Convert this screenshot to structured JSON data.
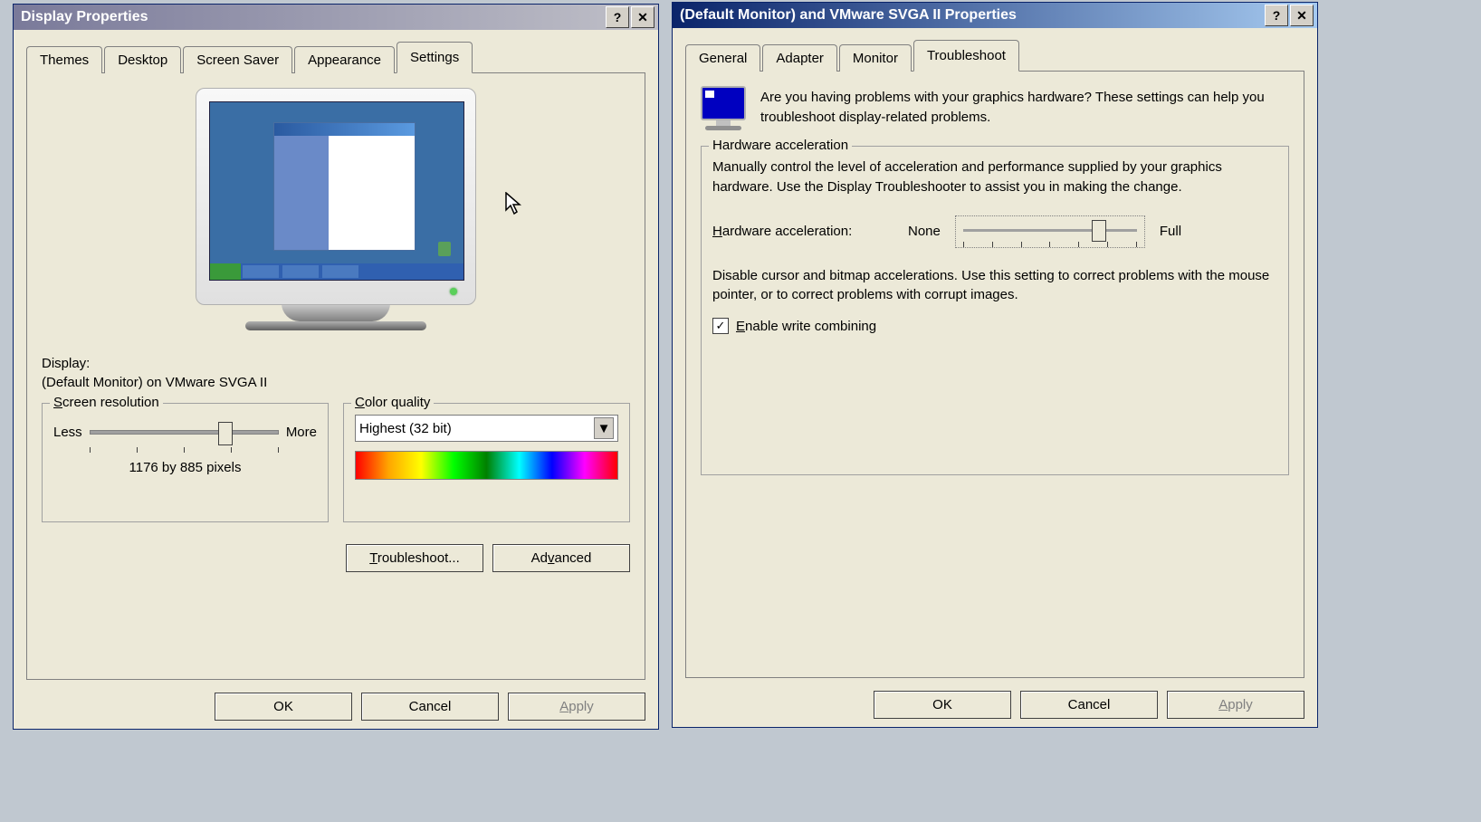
{
  "window1": {
    "title": "Display Properties",
    "tabs": [
      "Themes",
      "Desktop",
      "Screen Saver",
      "Appearance",
      "Settings"
    ],
    "active_tab": 4,
    "display_label": "Display:",
    "display_value": "(Default Monitor) on VMware SVGA II",
    "resolution": {
      "group_title": "Screen resolution",
      "less": "Less",
      "more": "More",
      "value_text": "1176 by 885 pixels"
    },
    "color": {
      "group_title": "Color quality",
      "selected": "Highest (32 bit)"
    },
    "troubleshoot_btn": "Troubleshoot...",
    "advanced_btn": "Advanced",
    "ok": "OK",
    "cancel": "Cancel",
    "apply": "Apply"
  },
  "window2": {
    "title": "(Default Monitor) and VMware SVGA II Properties",
    "tabs": [
      "General",
      "Adapter",
      "Monitor",
      "Troubleshoot"
    ],
    "active_tab": 3,
    "help_text": "Are you having problems with your graphics hardware? These settings can help you troubleshoot display-related problems.",
    "hw_group": "Hardware acceleration",
    "hw_intro": "Manually control the level of acceleration and performance supplied by your graphics hardware. Use the Display Troubleshooter to assist you in making the change.",
    "hw_label": "Hardware acceleration:",
    "none": "None",
    "full": "Full",
    "hw_desc": "Disable cursor and bitmap accelerations. Use this setting to correct problems with the mouse pointer, or to correct problems with corrupt images.",
    "write_combining": "Enable write combining",
    "write_combining_checked": true,
    "ok": "OK",
    "cancel": "Cancel",
    "apply": "Apply"
  }
}
